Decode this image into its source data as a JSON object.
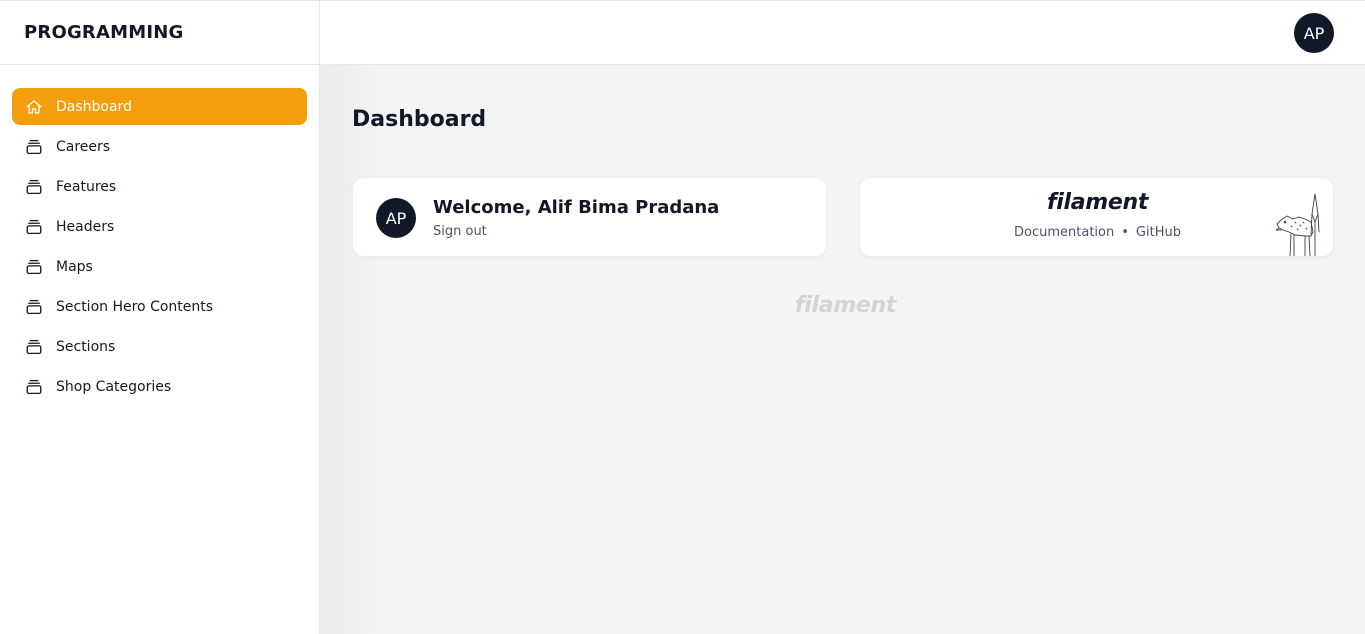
{
  "app": {
    "brand": "PROGRAMMING"
  },
  "user": {
    "initials": "AP"
  },
  "sidebar": {
    "items": [
      {
        "label": "Dashboard",
        "icon": "home-icon",
        "active": true
      },
      {
        "label": "Careers",
        "icon": "collection-icon",
        "active": false
      },
      {
        "label": "Features",
        "icon": "collection-icon",
        "active": false
      },
      {
        "label": "Headers",
        "icon": "collection-icon",
        "active": false
      },
      {
        "label": "Maps",
        "icon": "collection-icon",
        "active": false
      },
      {
        "label": "Section Hero Contents",
        "icon": "collection-icon",
        "active": false
      },
      {
        "label": "Sections",
        "icon": "collection-icon",
        "active": false
      },
      {
        "label": "Shop Categories",
        "icon": "collection-icon",
        "active": false
      }
    ]
  },
  "page": {
    "title": "Dashboard"
  },
  "welcome_card": {
    "avatar": "AP",
    "greeting": "Welcome, Alif Bima Pradana",
    "signout": "Sign out"
  },
  "filament_card": {
    "logo": "filament",
    "documentation": "Documentation",
    "separator": "•",
    "github": "GitHub"
  },
  "footer": {
    "logo": "filament"
  },
  "colors": {
    "accent": "#f59e0b",
    "dark": "#111827",
    "background": "#f3f4f6"
  }
}
